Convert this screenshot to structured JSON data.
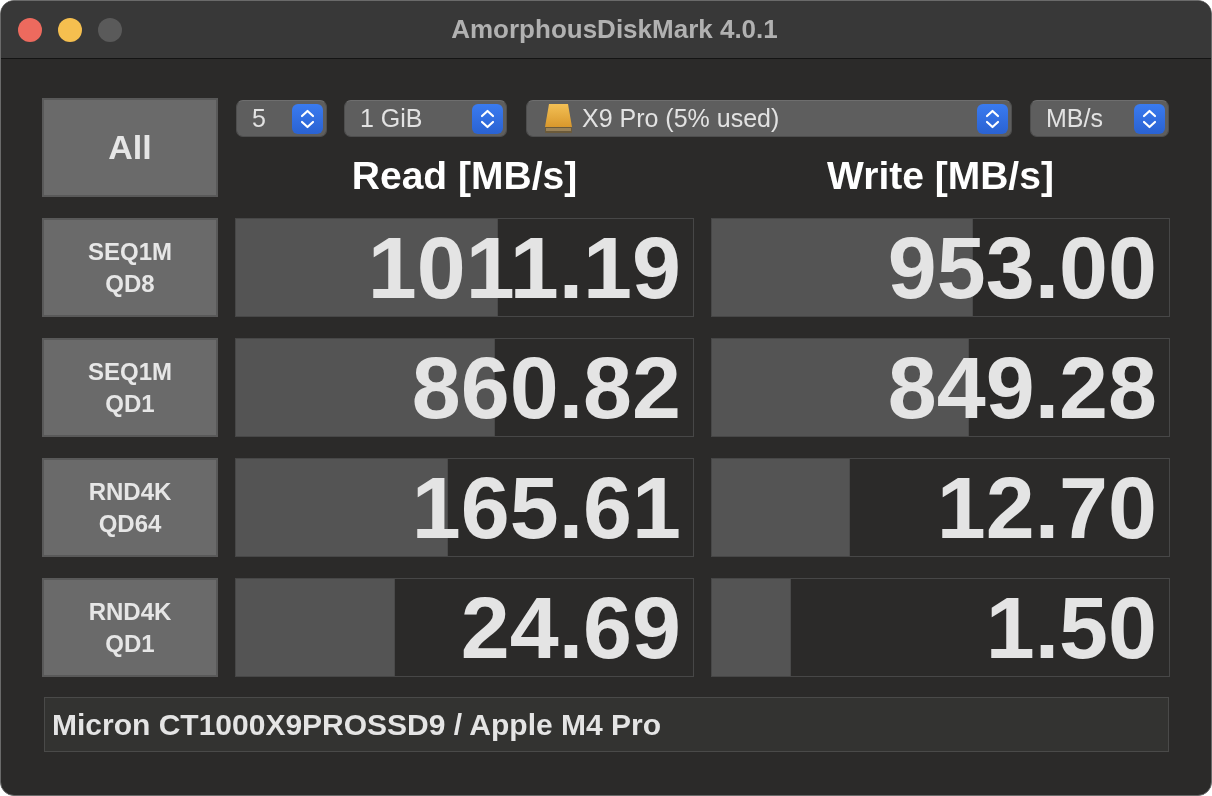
{
  "window": {
    "title": "AmorphousDiskMark 4.0.1",
    "buttons": [
      {
        "kind": "close",
        "disabled": false
      },
      {
        "kind": "minimize",
        "disabled": false
      },
      {
        "kind": "zoom",
        "disabled": true
      }
    ]
  },
  "all_button": {
    "label": "All"
  },
  "selectors": [
    {
      "kind": "plain",
      "value": "5"
    },
    {
      "kind": "plain",
      "value": "1 GiB"
    },
    {
      "kind": "drive",
      "value": "X9 Pro (5% used)"
    },
    {
      "kind": "plain",
      "value": "MB/s"
    }
  ],
  "headers": [
    "Read [MB/s]",
    "Write [MB/s]"
  ],
  "rows": [
    {
      "test": "SEQ1M",
      "queue_depth": "QD8",
      "read": {
        "value": "1011.19",
        "level": 0.574
      },
      "write": {
        "value": "953.00",
        "level": 0.572
      }
    },
    {
      "test": "SEQ1M",
      "queue_depth": "QD1",
      "read": {
        "value": "860.82",
        "level": 0.566
      },
      "write": {
        "value": "849.28",
        "level": 0.563
      }
    },
    {
      "test": "RND4K",
      "queue_depth": "QD64",
      "read": {
        "value": "165.61",
        "level": 0.463
      },
      "write": {
        "value": "12.70",
        "level": 0.303
      }
    },
    {
      "test": "RND4K",
      "queue_depth": "QD1",
      "read": {
        "value": "24.69",
        "level": 0.347
      },
      "write": {
        "value": "1.50",
        "level": 0.172
      }
    }
  ],
  "comment": {
    "value": "Micron CT1000X9PROSSD9 / Apple M4 Pro"
  }
}
